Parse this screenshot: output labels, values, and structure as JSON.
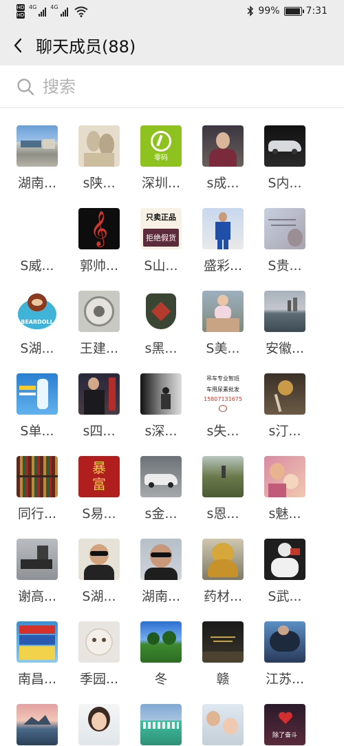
{
  "status_bar": {
    "sim_badges": [
      "HD",
      "HD"
    ],
    "network": [
      "4G",
      "4G"
    ],
    "battery": "99%",
    "battery_level": 0.99,
    "time": "7:31",
    "icons": [
      "signal-icon",
      "wifi-icon",
      "bluetooth-icon",
      "battery-icon"
    ]
  },
  "header": {
    "title": "聊天成员(88)",
    "back_icon": "chevron-left-icon"
  },
  "search": {
    "placeholder": "搜索",
    "value": "",
    "icon": "search-icon"
  },
  "avatar_texts": {
    "lingma": "零码",
    "genuine_top": "只卖正品",
    "genuine_bottom": "拒绝假货",
    "bearbrand": "BEARDOLL",
    "wholesale_l1": "吊车专业智班",
    "wholesale_l2": "车用尿素批发",
    "wholesale_l3": "15807131675",
    "baofu_top": "暴",
    "baofu_bottom": "富",
    "heart_caption": "除了奋斗"
  },
  "members": [
    {
      "name": "湖南..."
    },
    {
      "name": "s陕..."
    },
    {
      "name": "深圳..."
    },
    {
      "name": "s成..."
    },
    {
      "name": "S内..."
    },
    {
      "name": "S威..."
    },
    {
      "name": "郭帅..."
    },
    {
      "name": "S山..."
    },
    {
      "name": "盛彩..."
    },
    {
      "name": "S贵..."
    },
    {
      "name": "S湖..."
    },
    {
      "name": "王建..."
    },
    {
      "name": "s黑..."
    },
    {
      "name": "S美..."
    },
    {
      "name": "安徽..."
    },
    {
      "name": "S单..."
    },
    {
      "name": "s四..."
    },
    {
      "name": "s深..."
    },
    {
      "name": "s失..."
    },
    {
      "name": "s汀..."
    },
    {
      "name": "同行..."
    },
    {
      "name": "S易..."
    },
    {
      "name": "s金..."
    },
    {
      "name": "s恩..."
    },
    {
      "name": "s魅..."
    },
    {
      "name": "谢高..."
    },
    {
      "name": "S湖..."
    },
    {
      "name": "湖南..."
    },
    {
      "name": "药材..."
    },
    {
      "name": "S武..."
    },
    {
      "name": "南昌..."
    },
    {
      "name": "季园..."
    },
    {
      "name": "冬"
    },
    {
      "name": "赣"
    },
    {
      "name": "江苏..."
    },
    {
      "name": ""
    },
    {
      "name": ""
    },
    {
      "name": ""
    },
    {
      "name": ""
    },
    {
      "name": ""
    }
  ]
}
